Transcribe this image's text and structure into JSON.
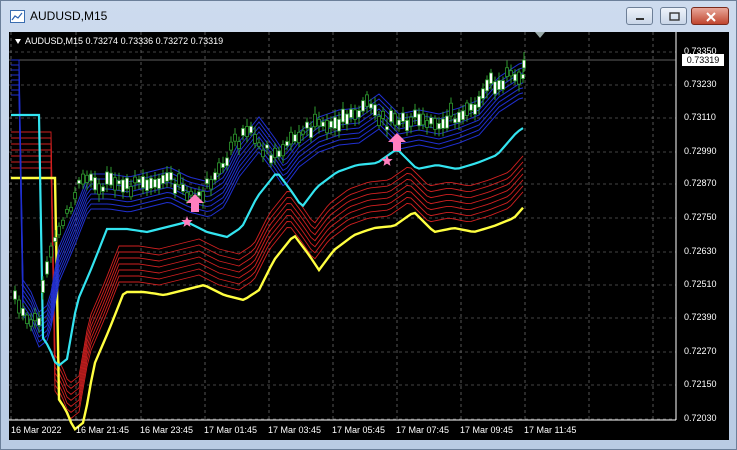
{
  "window": {
    "title": "AUDUSD,M15"
  },
  "chart": {
    "info": {
      "symbol": "AUDUSD,M15",
      "ohlc": "0.73274 0.73336 0.73272 0.73319"
    },
    "current_price": "0.73319",
    "y_labels": [
      "0.73350",
      "0.73230",
      "0.73110",
      "0.72990",
      "0.72870",
      "0.72750",
      "0.72630",
      "0.72510",
      "0.72390",
      "0.72270",
      "0.72150",
      "0.72030"
    ],
    "x_labels": [
      "16 Mar 2022",
      "16 Mar 21:45",
      "16 Mar 23:45",
      "17 Mar 01:45",
      "17 Mar 03:45",
      "17 Mar 05:45",
      "17 Mar 07:45",
      "17 Mar 09:45",
      "17 Mar 11:45"
    ],
    "colors": {
      "background": "#000000",
      "grid": "#8a8a8a",
      "bull_candle": "#ffffff",
      "candle_outline": "#2f9b2f",
      "fast_ma_bundle": "#2030d0",
      "cyan_ma": "#33e4f0",
      "slow_ma_bundle": "#d02020",
      "yellow_ma": "#ffff40",
      "signal_arrow": "#ff7fbf"
    },
    "signals": [
      {
        "type": "buy-arrow",
        "icon": "up-arrow-icon"
      },
      {
        "type": "buy-arrow",
        "icon": "up-arrow-icon"
      }
    ]
  },
  "chart_data": {
    "type": "candlestick",
    "symbol": "AUDUSD",
    "timeframe": "M15",
    "ylim": [
      0.7196,
      0.7342
    ],
    "x_ticks": [
      "16 Mar 2022",
      "16 Mar 21:45",
      "16 Mar 23:45",
      "17 Mar 01:45",
      "17 Mar 03:45",
      "17 Mar 05:45",
      "17 Mar 07:45",
      "17 Mar 09:45",
      "17 Mar 11:45"
    ],
    "y_ticks": [
      0.7335,
      0.7323,
      0.7311,
      0.7299,
      0.7287,
      0.7275,
      0.7263,
      0.7251,
      0.7239,
      0.7227,
      0.7215,
      0.7203
    ],
    "last_bar": {
      "open": 0.73274,
      "high": 0.73336,
      "low": 0.73272,
      "close": 0.73319
    }
  }
}
